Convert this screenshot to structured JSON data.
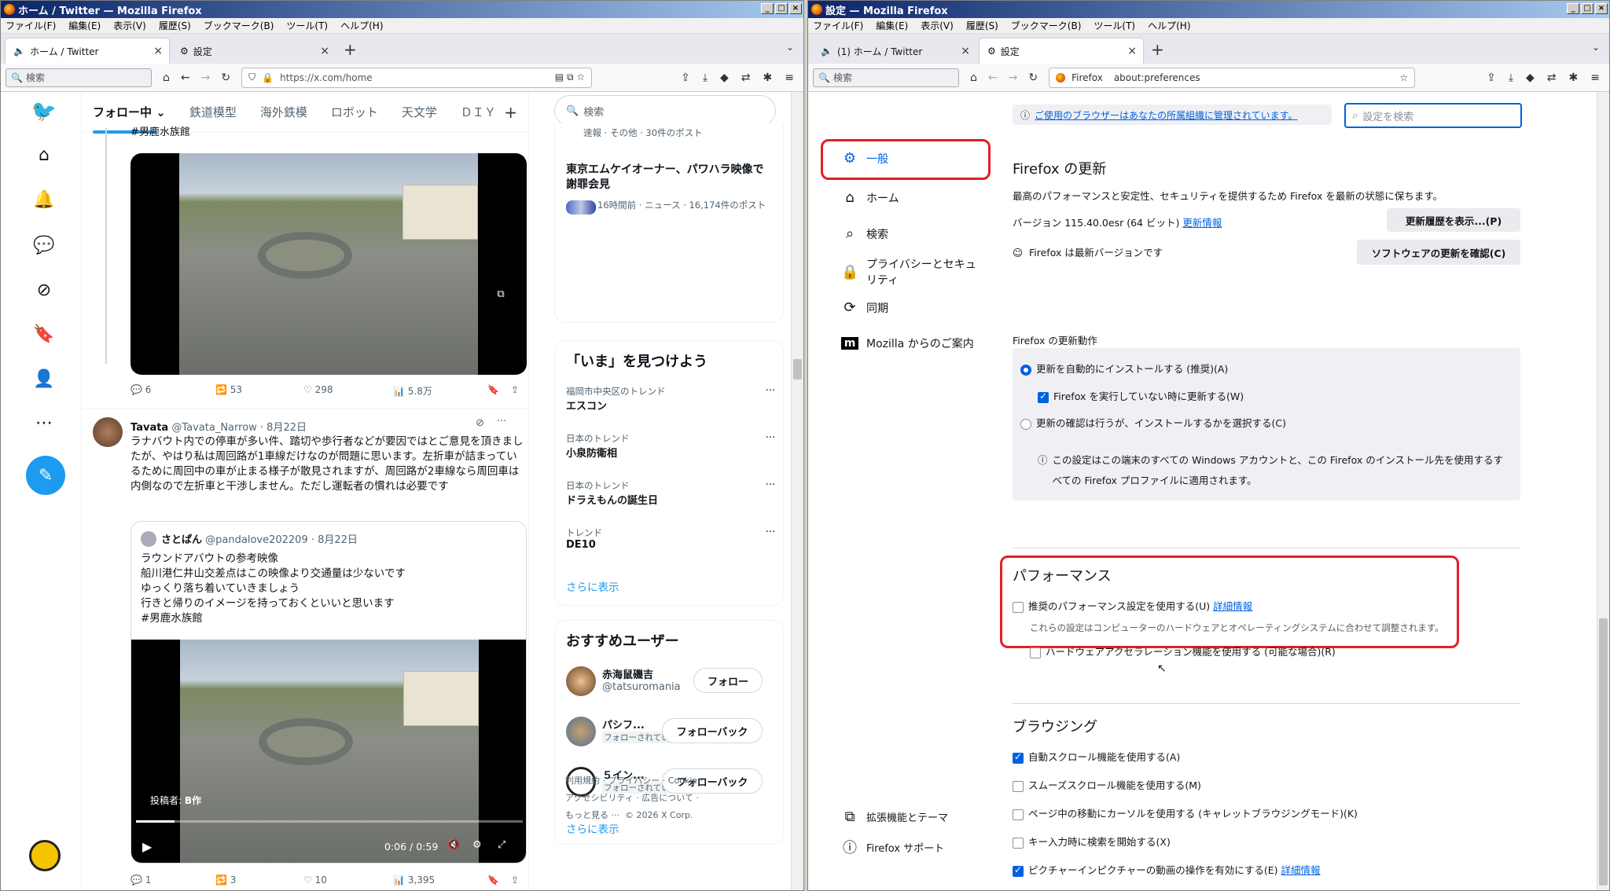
{
  "left_window": {
    "title": "ホーム / Twitter — Mozilla Firefox",
    "menu": [
      "ファイル(F)",
      "編集(E)",
      "表示(V)",
      "履歴(S)",
      "ブックマーク(B)",
      "ツール(T)",
      "ヘルプ(H)"
    ],
    "tabs": [
      {
        "label": "ホーム / Twitter"
      },
      {
        "label": "設定"
      }
    ],
    "search_placeholder": "検索",
    "url": "https://x.com/home",
    "feed_tabs": [
      "フォロー中",
      "鉄道模型",
      "海外鉄模",
      "ロボット",
      "天文学",
      "ＤＩＹ"
    ],
    "top_tweet_text": "#男鹿水族館",
    "tweet1_actions": {
      "replies": "6",
      "retweets": "53",
      "likes": "298",
      "views": "5.8万"
    },
    "tweet2": {
      "name": "Tavata",
      "handle": "@Tavata_Narrow · 8月22日",
      "text": "ラナバウト内での停車が多い件、踏切や歩行者などが要因ではとご意見を頂きましたが、やはり私は周回路が1車線だけなのが問題に思います。左折車が詰まっているために周回中の車が止まる様子が散見されますが、周回路が2車線なら周回車は内側なので左折車と干渉しません。ただし運転者の慣れは必要です",
      "quote": {
        "name": "さとぱん",
        "handle": "@pandalove202209 · 8月22日",
        "lines": [
          "ラウンドアバウトの参考映像",
          "船川港仁井山交差点はこの映像より交通量は少ないです",
          "ゆっくり落ち着いていきましょう",
          "行きと帰りのイメージを持っておくといいと思います",
          "#男鹿水族館"
        ],
        "poster": "投稿者:",
        "poster_name": "B作",
        "time": "0:06 / 0:59"
      },
      "actions": {
        "replies": "1",
        "retweets": "3",
        "likes": "10",
        "views": "3,395"
      }
    },
    "right": {
      "search_placeholder": "検索",
      "trend_top_meta": "速報 · その他 · 30件のポスト",
      "trend_news_title": "東京エムケイオーナー、パワハラ映像で謝罪会見",
      "trend_news_meta": "16時間前 · ニュース · 16,174件のポスト",
      "explore_title": "「いま」を見つけよう",
      "trends": [
        {
          "meta": "福岡市中央区のトレンド",
          "name": "エスコン"
        },
        {
          "meta": "日本のトレンド",
          "name": "小泉防衛相"
        },
        {
          "meta": "日本のトレンド",
          "name": "ドラえもんの誕生日"
        },
        {
          "meta": "トレンド",
          "name": "DE10"
        }
      ],
      "show_more": "さらに表示",
      "who_title": "おすすめユーザー",
      "users": [
        {
          "name": "赤海鼠磯吉",
          "handle": "@tatsuromania",
          "button": "フォロー"
        },
        {
          "name": "パシフ...",
          "handle": "フォローされています",
          "button": "フォローバック"
        },
        {
          "name": "５イン...",
          "handle": "フォローされています",
          "button": "フォローバック"
        }
      ],
      "show_more2": "さらに表示",
      "footer": [
        "利用規約",
        "·",
        "プライバシー",
        "·",
        "Cookie",
        "·",
        "アクセシビリティ",
        "·",
        "広告について",
        "·",
        "もっと見る ···",
        "© 2026 X Corp."
      ]
    }
  },
  "right_window": {
    "title": "設定 — Mozilla Firefox",
    "menu": [
      "ファイル(F)",
      "編集(E)",
      "表示(V)",
      "履歴(S)",
      "ブックマーク(B)",
      "ツール(T)",
      "ヘルプ(H)"
    ],
    "tabs": [
      {
        "label": "(1) ホーム / Twitter"
      },
      {
        "label": "設定"
      }
    ],
    "search_placeholder": "検索",
    "url_label": "Firefox",
    "url": "about:preferences",
    "sidebar": [
      "一般",
      "ホーム",
      "検索",
      "プライバシーとセキュリティ",
      "同期",
      "Mozilla からのご案内"
    ],
    "sidebar_bottom": [
      "拡張機能とテーマ",
      "Firefox サポート"
    ],
    "managed_notice": "ご使用のブラウザーはあなたの所属組織に管理されています。",
    "find_placeholder": "設定を検索",
    "update": {
      "title": "Firefox の更新",
      "desc": "最高のパフォーマンスと安定性、セキュリティを提供するため Firefox を最新の状態に保ちます。",
      "version": "バージョン 115.40.0esr (64 ビット)",
      "version_link": "更新情報",
      "history_btn": "更新履歴を表示...(P)",
      "status": "Firefox は最新バージョンです",
      "check_btn": "ソフトウェアの更新を確認(C)",
      "behavior_title": "Firefox の更新動作",
      "opt_auto": "更新を自動的にインストールする (推奨)(A)",
      "opt_bg": "Firefox を実行していない時に更新する(W)",
      "opt_check": "更新の確認は行うが、インストールするかを選択する(C)",
      "note": "この設定はこの端末のすべての Windows アカウントと、この Firefox のインストール先を使用するすべての Firefox プロファイルに適用されます。"
    },
    "performance": {
      "title": "パフォーマンス",
      "recommended": "推奨のパフォーマンス設定を使用する(U)",
      "recommended_link": "詳細情報",
      "recommended_desc": "これらの設定はコンピューターのハードウェアとオペレーティングシステムに合わせて調整されます。",
      "hwaccel": "ハードウェアアクセラレーション機能を使用する (可能な場合)(R)"
    },
    "browsing": {
      "title": "ブラウジング",
      "autoscroll": "自動スクロール機能を使用する(A)",
      "smooth": "スムーズスクロール機能を使用する(M)",
      "caret": "ページ中の移動にカーソルを使用する (キャレットブラウジングモード)(K)",
      "findtype": "キー入力時に検索を開始する(X)",
      "pip": "ピクチャーインピクチャーの動画の操作を有効にする(E)",
      "pip_link": "詳細情報"
    }
  }
}
